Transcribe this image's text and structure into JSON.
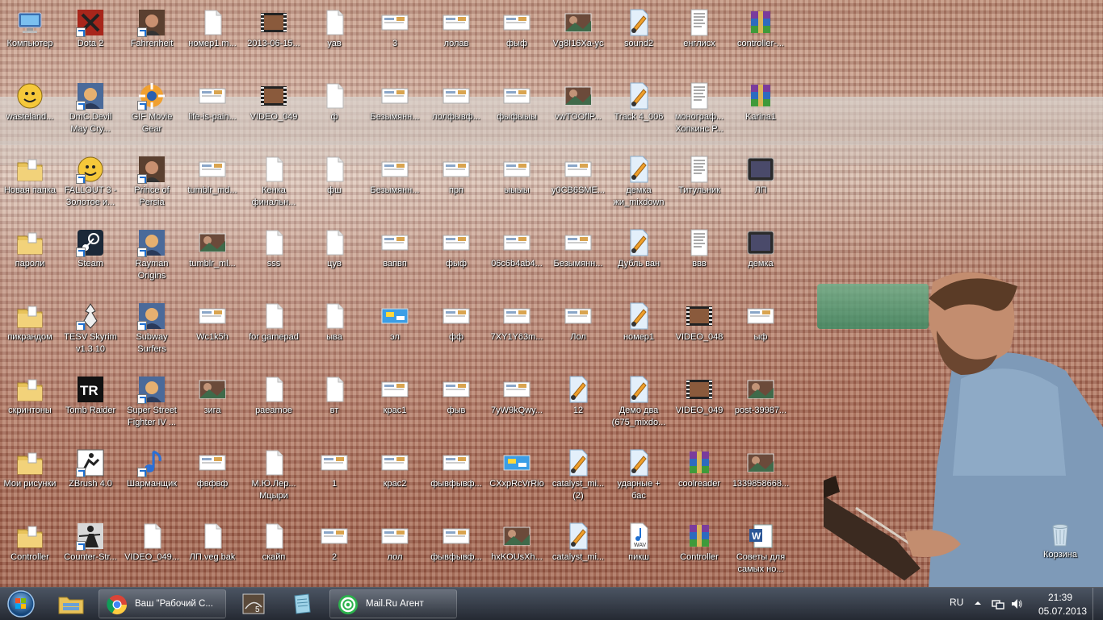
{
  "desktop": {
    "icons": [
      {
        "label": "Компьютер",
        "type": "computer"
      },
      {
        "label": "Dota 2",
        "type": "app-dota",
        "shortcut": true
      },
      {
        "label": "Fahrenheit",
        "type": "app-photo",
        "shortcut": true
      },
      {
        "label": "номер1.m...",
        "type": "file"
      },
      {
        "label": "2013-06-15...",
        "type": "video"
      },
      {
        "label": "уав",
        "type": "file"
      },
      {
        "label": "3",
        "type": "image"
      },
      {
        "label": "лолав",
        "type": "image"
      },
      {
        "label": "фыф",
        "type": "image"
      },
      {
        "label": "Vg8I16Xa-yc",
        "type": "image-color"
      },
      {
        "label": "sound2",
        "type": "audio"
      },
      {
        "label": "енглисх",
        "type": "doc"
      },
      {
        "label": "controller-...",
        "type": "archive"
      },
      {
        "label": "wasteland...",
        "type": "app-fallout"
      },
      {
        "label": "DmC.Devil May Cry...",
        "type": "app-game",
        "shortcut": true
      },
      {
        "label": "GIF Movie Gear",
        "type": "app-gif",
        "shortcut": true
      },
      {
        "label": "life-is-pain...",
        "type": "image"
      },
      {
        "label": "VIDEO_049",
        "type": "video"
      },
      {
        "label": "ф",
        "type": "file"
      },
      {
        "label": "Безымянн...",
        "type": "image"
      },
      {
        "label": "лолфывф...",
        "type": "image"
      },
      {
        "label": "фыфыыы",
        "type": "image"
      },
      {
        "label": "vwTOOflP...",
        "type": "image-color"
      },
      {
        "label": "Track 4_006",
        "type": "audio"
      },
      {
        "label": "монограф... Хопкинс Р...",
        "type": "doc"
      },
      {
        "label": "Karina1",
        "type": "archive"
      },
      {
        "label": "Новая папка",
        "type": "folder"
      },
      {
        "label": "FALLOUT 3 - Золотое и...",
        "type": "app-fallout",
        "shortcut": true
      },
      {
        "label": "Prince of Persia",
        "type": "app-photo",
        "shortcut": true
      },
      {
        "label": "tumblr_md...",
        "type": "image"
      },
      {
        "label": "Кенка финальн...",
        "type": "file"
      },
      {
        "label": "фш",
        "type": "file"
      },
      {
        "label": "Безымянн...",
        "type": "image"
      },
      {
        "label": "прп",
        "type": "image"
      },
      {
        "label": "ыыыы",
        "type": "image"
      },
      {
        "label": "y0CB6SME...",
        "type": "image"
      },
      {
        "label": "демка жи_mixdown",
        "type": "audio"
      },
      {
        "label": "Титульник",
        "type": "doc"
      },
      {
        "label": "ЛП",
        "type": "app-dark"
      },
      {
        "label": "пароли",
        "type": "folder"
      },
      {
        "label": "Steam",
        "type": "app-steam",
        "shortcut": true
      },
      {
        "label": "Rayman Origins",
        "type": "app-game",
        "shortcut": true
      },
      {
        "label": "tumblr_ml...",
        "type": "image-color"
      },
      {
        "label": "sss",
        "type": "file"
      },
      {
        "label": "цув",
        "type": "file"
      },
      {
        "label": "вапвп",
        "type": "image"
      },
      {
        "label": "фыф",
        "type": "image"
      },
      {
        "label": "06c6b4ab4...",
        "type": "image"
      },
      {
        "label": "Безымянн...",
        "type": "image"
      },
      {
        "label": "Дубль ван",
        "type": "audio"
      },
      {
        "label": "ввв",
        "type": "doc"
      },
      {
        "label": "демка",
        "type": "app-dark"
      },
      {
        "label": "пикрандом",
        "type": "folder"
      },
      {
        "label": "TESV Skyrim v1.3.10",
        "type": "app-skyrim",
        "shortcut": true
      },
      {
        "label": "Subway Surfers",
        "type": "app-game",
        "shortcut": true
      },
      {
        "label": "Wc1k5h",
        "type": "image"
      },
      {
        "label": "for gamepad",
        "type": "file"
      },
      {
        "label": "ыва",
        "type": "file"
      },
      {
        "label": "эл",
        "type": "image-blue"
      },
      {
        "label": "фф",
        "type": "image"
      },
      {
        "label": "7XY1Y63m...",
        "type": "image"
      },
      {
        "label": "Лол",
        "type": "image"
      },
      {
        "label": "номер1",
        "type": "audio"
      },
      {
        "label": "VIDEO_048",
        "type": "video"
      },
      {
        "label": "ыф",
        "type": "image"
      },
      {
        "label": "скринтоны",
        "type": "folder"
      },
      {
        "label": "Tomb Raider",
        "type": "app-tr"
      },
      {
        "label": "Super Street Fighter IV ...",
        "type": "app-game",
        "shortcut": true
      },
      {
        "label": "зига",
        "type": "image-color"
      },
      {
        "label": "paeamoe",
        "type": "file"
      },
      {
        "label": "вт",
        "type": "file"
      },
      {
        "label": "крас1",
        "type": "image"
      },
      {
        "label": "фыв",
        "type": "image"
      },
      {
        "label": "7yW9kQwy...",
        "type": "image"
      },
      {
        "label": "12",
        "type": "audio"
      },
      {
        "label": "Демо два (675_mixdo...",
        "type": "audio"
      },
      {
        "label": "VIDEO_049",
        "type": "video"
      },
      {
        "label": "post-39987...",
        "type": "image-color"
      },
      {
        "label": "Мои рисунки",
        "type": "folder"
      },
      {
        "label": "ZBrush 4.0",
        "type": "app-zbrush",
        "shortcut": true
      },
      {
        "label": "Шарманщик",
        "type": "app-music",
        "shortcut": true
      },
      {
        "label": "фвфвф",
        "type": "image"
      },
      {
        "label": "М.Ю.Лер... Мцыри",
        "type": "file"
      },
      {
        "label": "1",
        "type": "image"
      },
      {
        "label": "крас2",
        "type": "image"
      },
      {
        "label": "фывфывф...",
        "type": "image"
      },
      {
        "label": "CXxpRcVrRio",
        "type": "image-blue"
      },
      {
        "label": "catalyst_mi... (2)",
        "type": "audio"
      },
      {
        "label": "ударные + бас",
        "type": "audio"
      },
      {
        "label": "coolreader",
        "type": "archive"
      },
      {
        "label": "1339858668...",
        "type": "image-color"
      },
      {
        "label": "Controller",
        "type": "folder"
      },
      {
        "label": "Counter-Str...",
        "type": "app-cs",
        "shortcut": true
      },
      {
        "label": "VIDEO_049...",
        "type": "file"
      },
      {
        "label": "ЛП.veg.bak",
        "type": "file"
      },
      {
        "label": "скайп",
        "type": "file"
      },
      {
        "label": "2",
        "type": "image"
      },
      {
        "label": "лол",
        "type": "image"
      },
      {
        "label": "фывфывф...",
        "type": "image"
      },
      {
        "label": "hxKOUsXh...",
        "type": "image-color"
      },
      {
        "label": "catalyst_mi...",
        "type": "audio"
      },
      {
        "label": "пикш",
        "type": "wav"
      },
      {
        "label": "Controller",
        "type": "archive"
      },
      {
        "label": "Советы для самых но...",
        "type": "word"
      }
    ],
    "recycle_bin": {
      "label": "Корзина"
    }
  },
  "taskbar": {
    "buttons": [
      {
        "label": "Ваш \"Рабочий С...",
        "icon": "chrome-icon"
      },
      {
        "label": "",
        "icon": "video-editor-icon"
      },
      {
        "label": "",
        "icon": "notepad-icon"
      },
      {
        "label": "Mail.Ru Агент",
        "icon": "mail-agent-icon"
      }
    ],
    "tray": {
      "lang": "RU",
      "time": "21:39",
      "date": "05.07.2013"
    }
  },
  "colors": {
    "taskbar": "#1f2633",
    "folder": "#e8c25a",
    "accent": "#1e6fd0"
  }
}
